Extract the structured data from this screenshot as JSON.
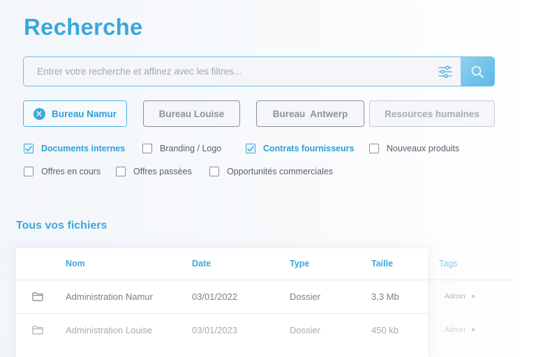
{
  "page": {
    "title": "Recherche"
  },
  "search": {
    "placeholder": "Entrer votre recherche et affinez avec les filtres...",
    "value": ""
  },
  "icons": {
    "filter": "sliders-icon",
    "search": "magnifier-icon",
    "chip_remove": "close-icon",
    "folder": "folder-icon",
    "check": "checkmark-icon"
  },
  "chips": [
    {
      "label": "Bureau Namur",
      "active": true
    },
    {
      "label": "Bureau Louise",
      "active": false
    },
    {
      "label": "Bureau  Antwerp",
      "active": false
    },
    {
      "label": "Resources humaines",
      "active": false
    }
  ],
  "checkboxes": [
    {
      "label": "Documents internes",
      "checked": true
    },
    {
      "label": "Branding / Logo",
      "checked": false
    },
    {
      "label": "Contrats fournisseurs",
      "checked": true
    },
    {
      "label": "Nouveaux produits",
      "checked": false
    },
    {
      "label": "Offres en cours",
      "checked": false
    },
    {
      "label": "Offres passées",
      "checked": false
    },
    {
      "label": "Opportunités commerciales",
      "checked": false
    }
  ],
  "files": {
    "title": "Tous vos fichiers",
    "columns": [
      "Nom",
      "Date",
      "Type",
      "Taille",
      "Tags"
    ],
    "rows": [
      {
        "name": "Administration Namur",
        "date": "03/01/2022",
        "type": "Dossier",
        "size": "3,3 Mb",
        "tag": "Admin"
      },
      {
        "name": "Administration Louise",
        "date": "03/01/2023",
        "type": "Dossier",
        "size": "450 kb",
        "tag": "Admin"
      }
    ]
  },
  "colors": {
    "accent": "#3aa9dc",
    "accent_light": "#8fd1f0",
    "text_muted": "#7a7f86"
  }
}
